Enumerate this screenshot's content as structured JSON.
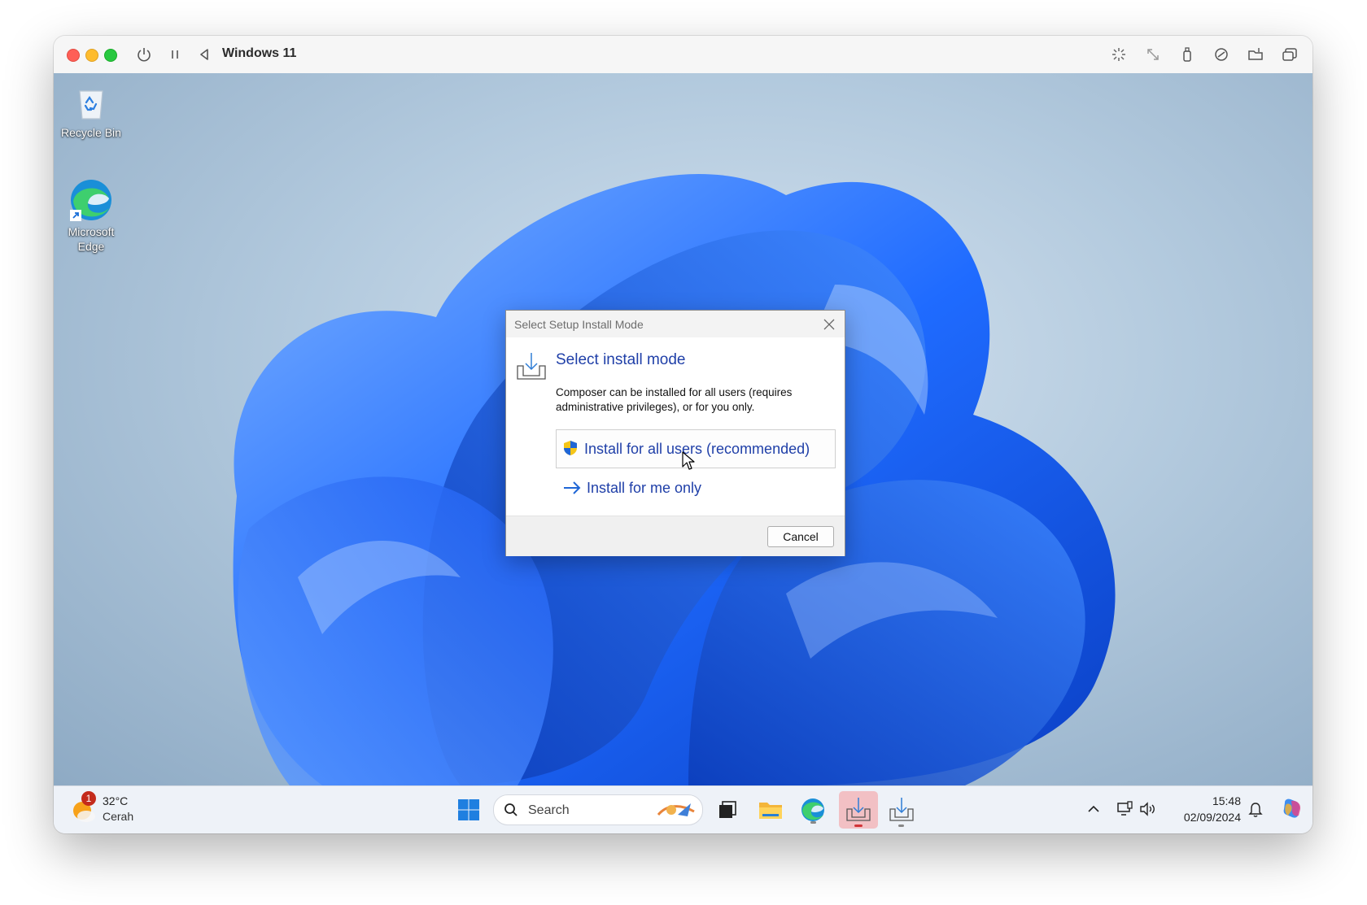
{
  "host_window": {
    "title": "Windows 11",
    "toolbar_icons": [
      "power-icon",
      "pause-icon",
      "back-icon",
      "brightness-icon",
      "resize-icon",
      "usb-icon",
      "accessibility-icon",
      "shared-folder-icon",
      "windows-icon"
    ]
  },
  "desktop": {
    "icons": [
      {
        "label": "Recycle Bin",
        "icon": "recycle-bin-icon"
      },
      {
        "label": "Microsoft Edge",
        "icon": "edge-icon"
      }
    ]
  },
  "dialog": {
    "title": "Select Setup Install Mode",
    "heading": "Select install mode",
    "description": "Composer can be installed for all users (requires administrative privileges), or for you only.",
    "option_all_users": "Install for all users (recommended)",
    "option_me_only": "Install for me only",
    "cancel_label": "Cancel"
  },
  "taskbar": {
    "weather": {
      "temperature": "32°C",
      "condition": "Cerah",
      "badge": "1"
    },
    "search_placeholder": "Search",
    "apps": [
      "start-icon",
      "task-view-icon",
      "file-explorer-icon",
      "edge-icon",
      "installer-icon",
      "installer-icon"
    ],
    "clock": {
      "time": "15:48",
      "date": "02/09/2024"
    }
  },
  "colors": {
    "link_blue": "#1f3fa8",
    "accent_blue": "#0067c0",
    "close_red": "#fe5f57",
    "minimize_yellow": "#febc2e",
    "maximize_green": "#28c840"
  }
}
